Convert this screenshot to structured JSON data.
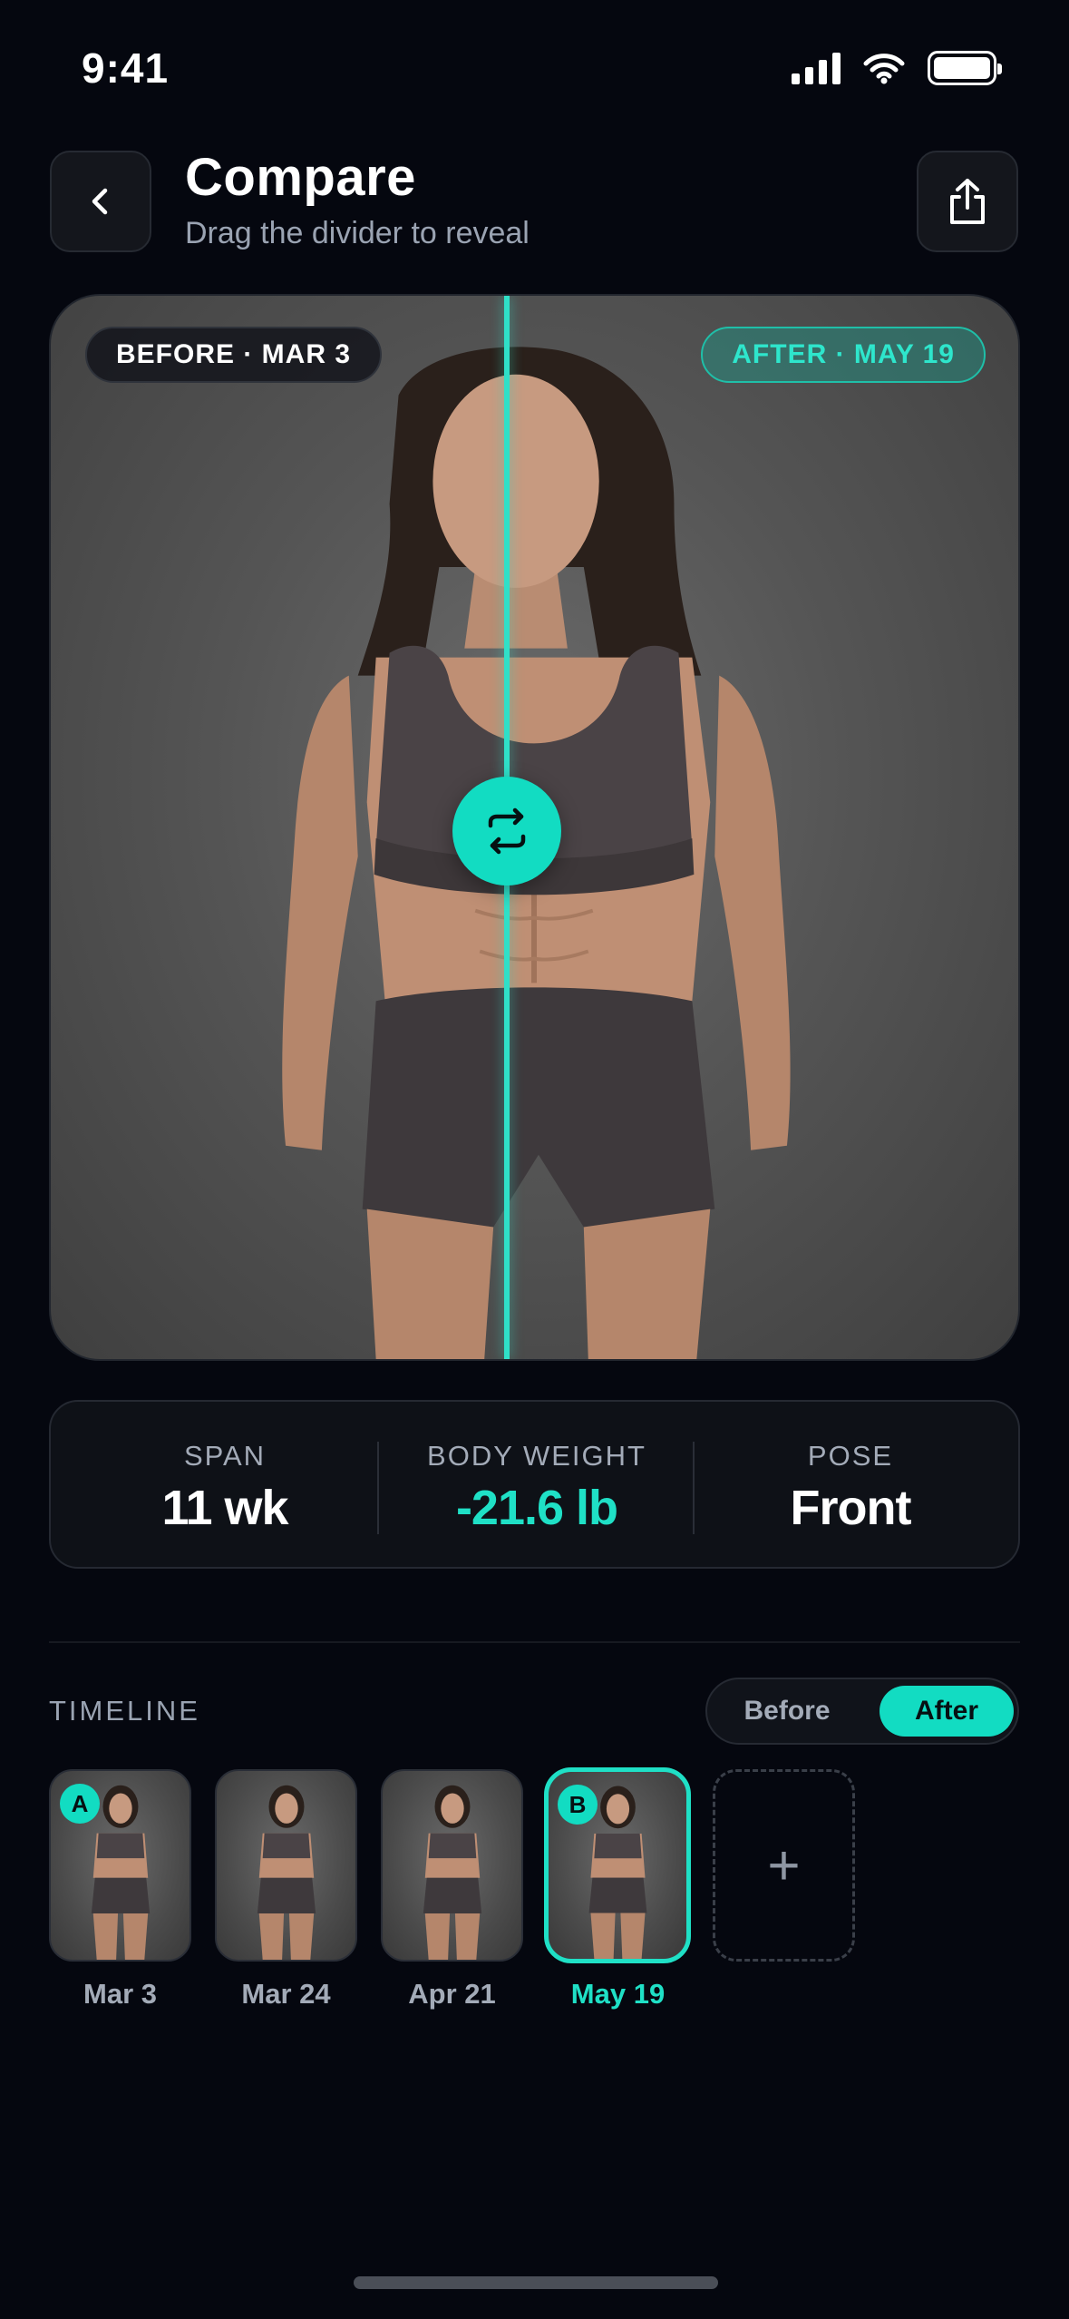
{
  "status_bar": {
    "time": "9:41"
  },
  "header": {
    "title": "Compare",
    "subtitle": "Drag the divider to reveal"
  },
  "compare": {
    "before_label": "BEFORE · MAR 3",
    "after_label": "AFTER · MAY 19",
    "accent_color": "#1fe0c6"
  },
  "stats": [
    {
      "label": "SPAN",
      "value": "11 wk"
    },
    {
      "label": "BODY WEIGHT",
      "value": "-21.6 lb"
    },
    {
      "label": "POSE",
      "value": "Front"
    }
  ],
  "timeline": {
    "label": "TIMELINE",
    "toggle": {
      "before": "Before",
      "after": "After",
      "selected": "After"
    },
    "thumbnails": [
      {
        "date": "Mar 3",
        "marker": "A"
      },
      {
        "date": "Mar 24",
        "marker": ""
      },
      {
        "date": "Apr 21",
        "marker": ""
      },
      {
        "date": "May 19",
        "marker": "B"
      }
    ],
    "add_label": "+"
  }
}
